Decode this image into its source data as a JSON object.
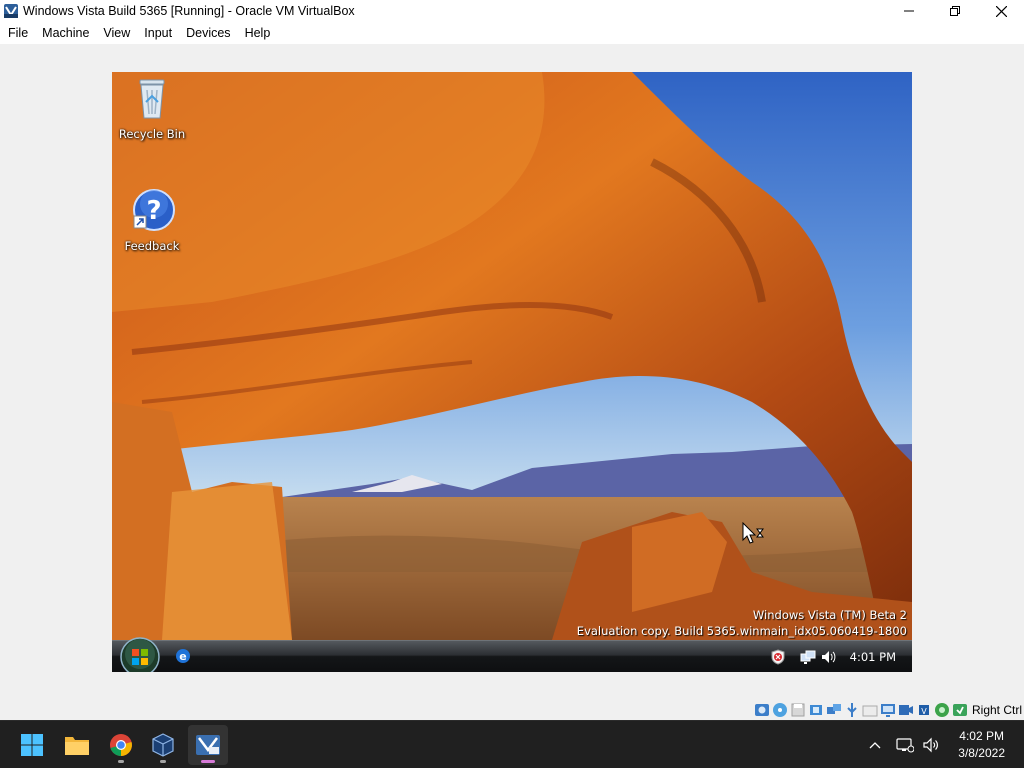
{
  "window": {
    "title": "Windows Vista Build 5365 [Running] - Oracle VM VirtualBox"
  },
  "menu": {
    "items": [
      "File",
      "Machine",
      "View",
      "Input",
      "Devices",
      "Help"
    ]
  },
  "guest": {
    "desktop_icons": [
      {
        "label": "Recycle Bin",
        "icon": "recycle-bin-icon"
      },
      {
        "label": "Feedback",
        "icon": "feedback-help-icon"
      }
    ],
    "watermark": {
      "line1": "Windows Vista (TM) Beta 2",
      "line2": "Evaluation copy. Build 5365.winmain_idx05.060419-1800"
    },
    "taskbar": {
      "clock": "4:01 PM",
      "quick_launch": [
        "internet-explorer-icon"
      ],
      "tray_icons": [
        "security-alert-icon",
        "network-icon",
        "volume-icon"
      ]
    }
  },
  "vbox_status": {
    "icons": [
      "hard-disk-icon",
      "optical-drive-icon",
      "floppy-icon",
      "audio-icon",
      "network-icon",
      "usb-icon",
      "shared-folders-icon",
      "display-icon",
      "recording-icon",
      "cpu-icon",
      "mouse-integration-icon",
      "keyboard-icon"
    ],
    "host_key": "Right Ctrl"
  },
  "host_taskbar": {
    "apps": [
      "start-icon",
      "file-explorer-icon",
      "chrome-icon",
      "virtualbox-manager-icon",
      "virtualbox-vm-icon"
    ],
    "time": "4:02 PM",
    "date": "3/8/2022"
  }
}
